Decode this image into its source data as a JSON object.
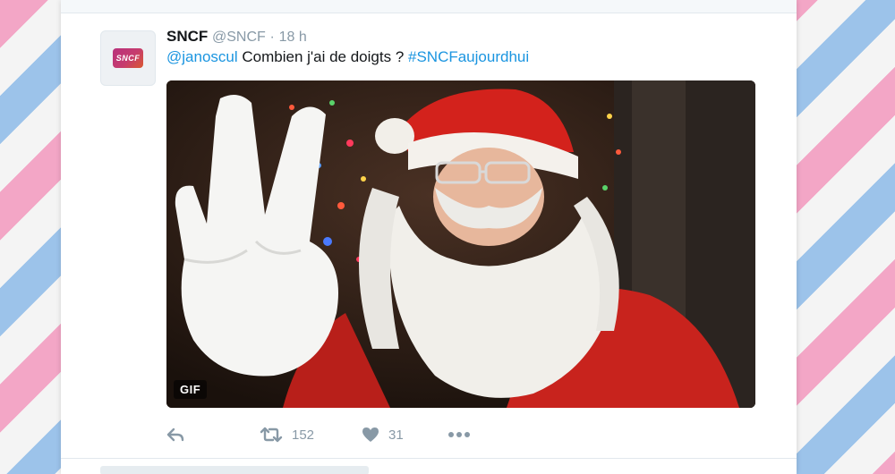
{
  "tweet": {
    "display_name": "SNCF",
    "handle": "@SNCF",
    "separator": "·",
    "time": "18 h",
    "avatar_logo_text": "SNCF",
    "text": {
      "mention": "@janoscul",
      "body": " Combien j'ai de doigts ? ",
      "hashtag": "#SNCFaujourdhui"
    },
    "media": {
      "badge": "GIF"
    },
    "actions": {
      "reply_icon": "reply-icon",
      "retweet_icon": "retweet-icon",
      "retweet_count": "152",
      "like_icon": "heart-icon",
      "like_count": "31",
      "more_icon": "more-icon"
    }
  },
  "colors": {
    "link": "#1b95e0",
    "muted": "#8899a6",
    "text": "#14171a",
    "stripe_pink": "#f3a6c6",
    "stripe_blue": "#9cc3ea"
  }
}
